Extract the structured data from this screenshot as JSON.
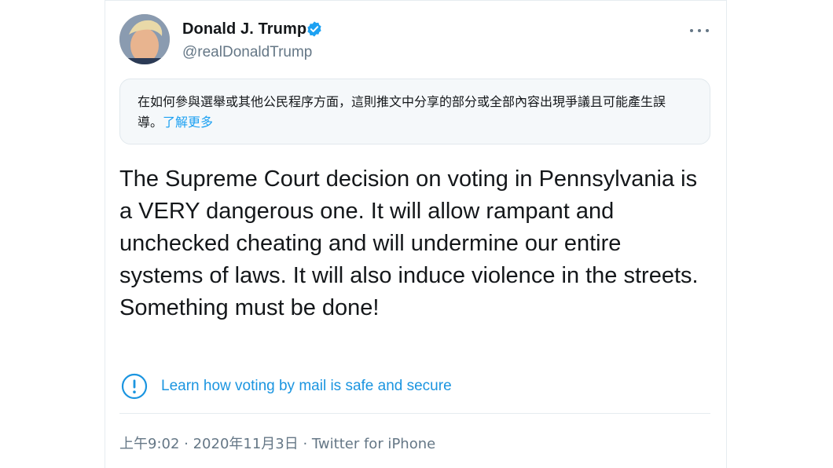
{
  "tweet": {
    "author_name": "Donald J. Trump",
    "author_handle": "@realDonaldTrump",
    "notice_text": "在如何參與選舉或其他公民程序方面，這則推文中分享的部分或全部內容出現爭議且可能產生誤導。",
    "notice_link": "了解更多",
    "text": "The Supreme Court decision on voting in Pennsylvania is a VERY dangerous one. It will allow rampant and unchecked cheating and will undermine our entire systems of laws. It will also induce violence in the streets. Something must be done!",
    "info_link": "Learn how voting by mail is safe and secure",
    "timestamp": "上午9:02 · 2020年11月3日 · Twitter for iPhone"
  },
  "colors": {
    "accent": "#1da1f2",
    "link": "#1b95e0",
    "text": "#14171a",
    "muted": "#657786",
    "notice_bg": "#f5f8fa"
  },
  "icons": {
    "verified": "verified-badge-icon",
    "more": "more-options-icon",
    "info": "exclamation-circle-icon"
  }
}
